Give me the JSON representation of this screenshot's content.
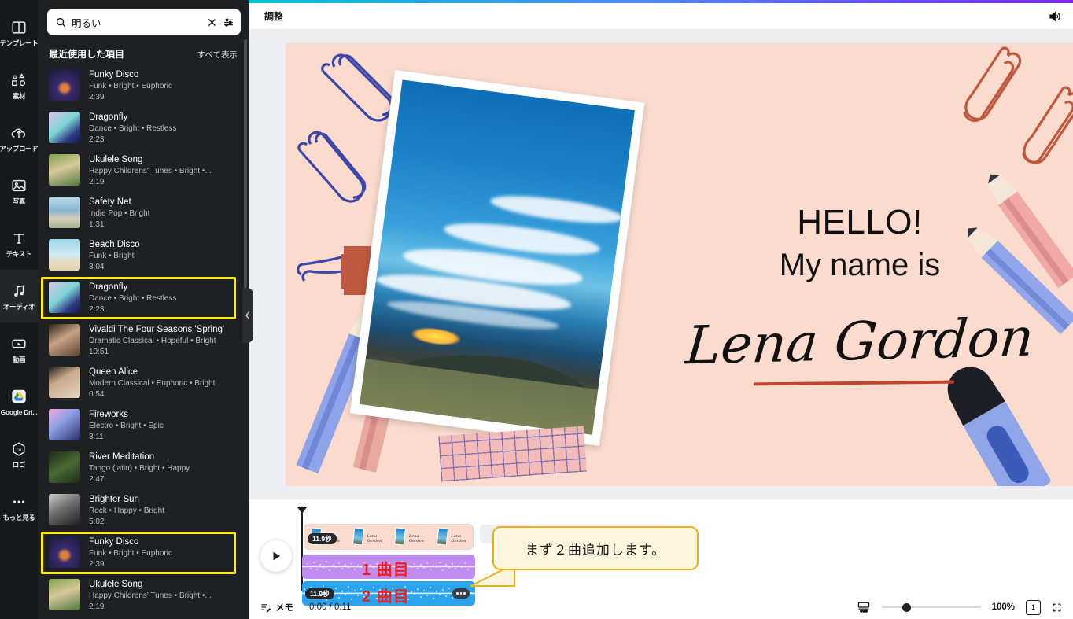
{
  "rail": {
    "items": [
      {
        "label": "テンプレート",
        "icon": "template-icon",
        "active": false
      },
      {
        "label": "素材",
        "icon": "elements-icon",
        "active": false
      },
      {
        "label": "アップロード",
        "icon": "upload-icon",
        "active": false
      },
      {
        "label": "写真",
        "icon": "photo-icon",
        "active": false
      },
      {
        "label": "テキスト",
        "icon": "text-icon",
        "active": false
      },
      {
        "label": "オーディオ",
        "icon": "audio-icon",
        "active": true
      },
      {
        "label": "動画",
        "icon": "video-icon",
        "active": false
      },
      {
        "label": "Google Dri...",
        "icon": "google-drive-icon",
        "active": false
      },
      {
        "label": "ロゴ",
        "icon": "logo-icon",
        "active": false
      },
      {
        "label": "もっと見る",
        "icon": "more-icon",
        "active": false
      }
    ]
  },
  "search": {
    "value": "明るい",
    "placeholder": "検索",
    "clear_icon": "close-icon",
    "filter_icon": "filter-icon",
    "search_icon": "search-icon"
  },
  "panel": {
    "section_title": "最近使用した項目",
    "see_all": "すべて表示",
    "tracks": [
      {
        "name": "Funky Disco",
        "tags": "Funk • Bright • Euphoric",
        "duration": "2:39",
        "highlight": false,
        "thumb": "disco-ball"
      },
      {
        "name": "Dragonfly",
        "tags": "Dance • Bright • Restless",
        "duration": "2:23",
        "highlight": false,
        "thumb": "dragonfly"
      },
      {
        "name": "Ukulele Song",
        "tags": "Happy Childrens' Tunes • Bright •...",
        "duration": "2:19",
        "highlight": false,
        "thumb": "ukulele"
      },
      {
        "name": "Safety Net",
        "tags": "Indie Pop • Bright",
        "duration": "1:31",
        "highlight": false,
        "thumb": "bikes"
      },
      {
        "name": "Beach Disco",
        "tags": "Funk • Bright",
        "duration": "3:04",
        "highlight": false,
        "thumb": "beach"
      },
      {
        "name": "Dragonfly",
        "tags": "Dance • Bright • Restless",
        "duration": "2:23",
        "highlight": true,
        "thumb": "dragonfly"
      },
      {
        "name": "Vivaldi The Four Seasons 'Spring'",
        "tags": "Dramatic Classical • Hopeful • Bright",
        "duration": "10:51",
        "highlight": false,
        "thumb": "portrait"
      },
      {
        "name": "Queen Alice",
        "tags": "Modern Classical • Euphoric • Bright",
        "duration": "0:54",
        "highlight": false,
        "thumb": "queen"
      },
      {
        "name": "Fireworks",
        "tags": "Electro • Bright • Epic",
        "duration": "3:11",
        "highlight": false,
        "thumb": "fireworks"
      },
      {
        "name": "River Meditation",
        "tags": "Tango (latin) • Bright • Happy",
        "duration": "2:47",
        "highlight": false,
        "thumb": "river"
      },
      {
        "name": "Brighter Sun",
        "tags": "Rock • Happy • Bright",
        "duration": "5:02",
        "highlight": false,
        "thumb": "rock"
      },
      {
        "name": "Funky Disco",
        "tags": "Funk • Bright • Euphoric",
        "duration": "2:39",
        "highlight": true,
        "thumb": "disco-ball"
      },
      {
        "name": "Ukulele Song",
        "tags": "Happy Childrens' Tunes • Bright •...",
        "duration": "2:19",
        "highlight": false,
        "thumb": "ukulele"
      }
    ]
  },
  "topbar": {
    "title": "調整",
    "volume_icon": "volume-icon"
  },
  "canvas": {
    "headline": "HELLO!",
    "subline": "My name is",
    "signature": "Lena Gordon",
    "background_color": "#fadbcd",
    "accent_color": "#c0452f"
  },
  "timeline": {
    "play_icon": "play-icon",
    "video_clip_duration": "11.9秒",
    "audio_tracks": [
      {
        "label": "1 曲目",
        "duration": "",
        "color": "#c08cf0"
      },
      {
        "label": "2 曲目",
        "duration": "11.9秒",
        "color": "#2aa4ef"
      }
    ],
    "callout": "まず２曲追加します。",
    "callout_color": "#eab11f",
    "memo_label": "メモ",
    "memo_icon": "notes-icon",
    "time_display": "0:00 / 0:11",
    "timing_icon": "timing-icon",
    "zoom_percent": "100%",
    "page_count": "1",
    "fullscreen_icon": "fullscreen-icon"
  }
}
